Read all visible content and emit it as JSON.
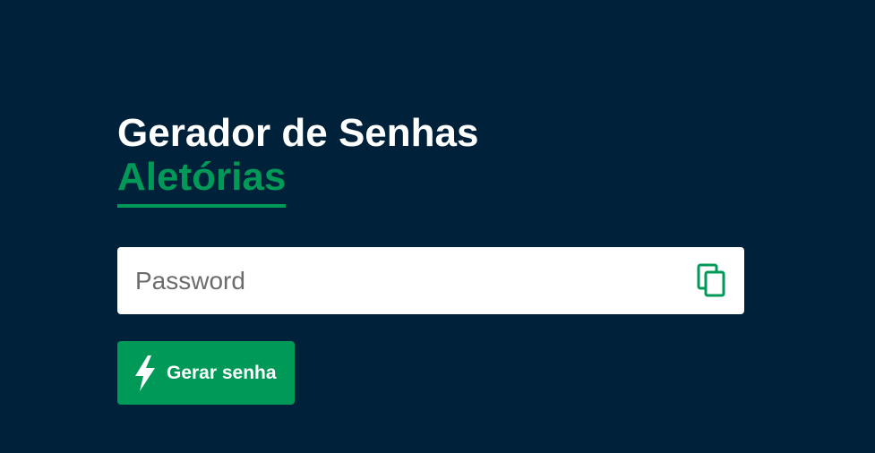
{
  "header": {
    "title_line1": "Gerador de Senhas",
    "title_line2": "Aletórias"
  },
  "password": {
    "placeholder": "Password",
    "value": "",
    "copy_icon": "copy-icon"
  },
  "generate_button": {
    "label": "Gerar senha",
    "icon": "lightning-bolt-icon"
  },
  "colors": {
    "background": "#00213a",
    "accent": "#009957",
    "title": "#ffffff"
  }
}
